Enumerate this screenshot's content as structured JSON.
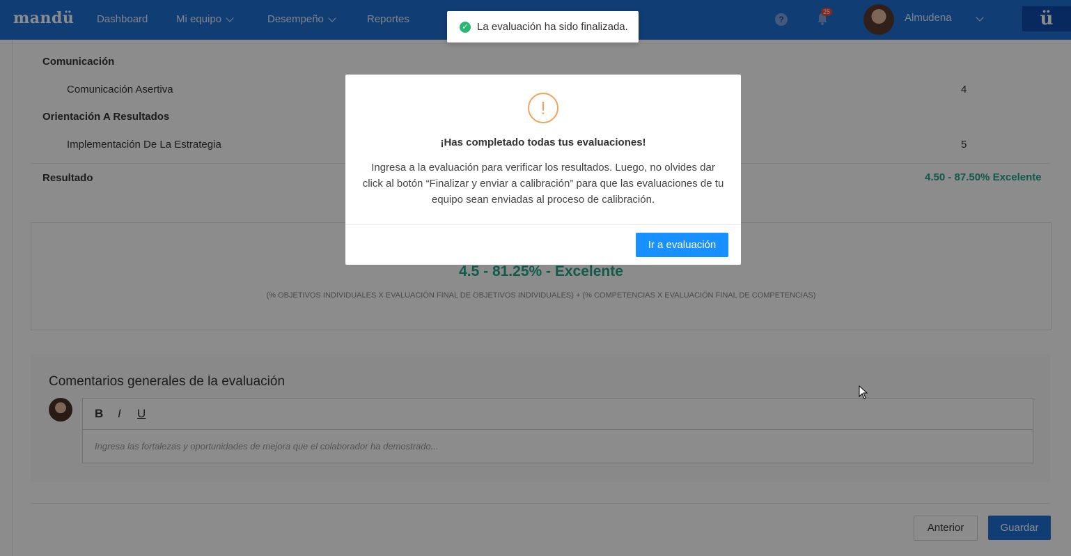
{
  "topbar": {
    "logo": "mandü",
    "nav": [
      "Dashboard",
      "Mi equipo",
      "Desempeño",
      "Reportes"
    ],
    "help_icon": "?",
    "notifications_count": "25",
    "user_name": "Almudena",
    "brand_mark": "ü"
  },
  "competencies": [
    {
      "group": "Comunicación",
      "item": "Comunicación Asertiva",
      "score": "4"
    },
    {
      "group": "Orientación A Resultados",
      "item": "Implementación De La Estrategia",
      "score": "5"
    }
  ],
  "result": {
    "label": "Resultado",
    "value": "4.50 - 87.50% Excelente"
  },
  "final": {
    "score": "4.5 - 81.25% - Excelente",
    "formula": "(% OBJETIVOS INDIVIDUALES X EVALUACIÓN FINAL DE OBJETIVOS INDIVIDUALES) + (% COMPETENCIAS X EVALUACIÓN FINAL DE COMPETENCIAS)"
  },
  "comments": {
    "title": "Comentarios generales de la evaluación",
    "toolbar": {
      "bold": "B",
      "italic": "I",
      "underline": "U"
    },
    "placeholder": "Ingresa las fortalezas y oportunidades de mejora que el colaborador ha demostrado..."
  },
  "footer": {
    "prev_label": "Anterior",
    "save_label": "Guardar"
  },
  "modal": {
    "icon": "!",
    "title": "¡Has completado todas tus evaluaciones!",
    "text": "Ingresa a la evaluación para verificar los resultados. Luego, no olvides dar click al botón “Finalizar y enviar a calibración” para que las evaluaciones de tu equipo sean enviadas al proceso de calibración.",
    "button": "Ir a evaluación"
  },
  "toast": {
    "text": "La evaluación ha sido finalizada."
  },
  "colors": {
    "primary": "#1f6fd6",
    "accent_green": "#20a58a",
    "warning": "#f0a35a",
    "success": "#2bb673"
  }
}
